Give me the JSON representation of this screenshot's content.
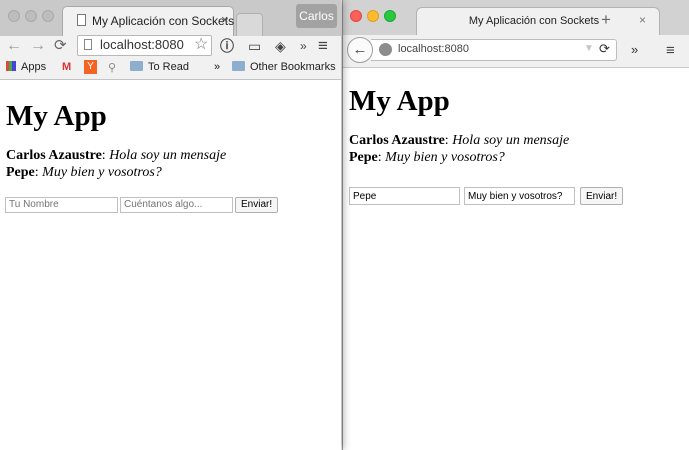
{
  "left_browser": {
    "tab_title": "My Aplicación con Sockets",
    "tab_close": "×",
    "profile": "Carlos",
    "url": "localhost:8080",
    "overflow": "»",
    "menu": "≡",
    "bookmarks": [
      "Apps",
      "To Read",
      "Other Bookmarks"
    ],
    "bookmarks_overflow": "»",
    "page": {
      "heading": "My App",
      "messages": [
        {
          "user": "Carlos Azaustre",
          "text": "Hola soy un mensaje"
        },
        {
          "user": "Pepe",
          "text": "Muy bien y vosotros?"
        }
      ],
      "name_placeholder": "Tu Nombre",
      "msg_placeholder": "Cuéntanos algo...",
      "name_value": "",
      "msg_value": "",
      "send_label": "Enviar!"
    }
  },
  "right_browser": {
    "tab_title": "My Aplicación con Sockets",
    "tab_close": "×",
    "new_tab": "+",
    "url": "localhost:8080",
    "overflow": "»",
    "menu": "≡",
    "page": {
      "heading": "My App",
      "messages": [
        {
          "user": "Carlos Azaustre",
          "text": "Hola soy un mensaje"
        },
        {
          "user": "Pepe",
          "text": "Muy bien y vosotros?"
        }
      ],
      "name_value": "Pepe",
      "msg_value": "Muy bien y vosotros?",
      "send_label": "Enviar!"
    }
  },
  "colors": {
    "traffic_red": "#fc5f57",
    "traffic_yellow": "#fdbc2e",
    "traffic_green": "#28c840",
    "profile_bg": "#a2a2a2"
  }
}
